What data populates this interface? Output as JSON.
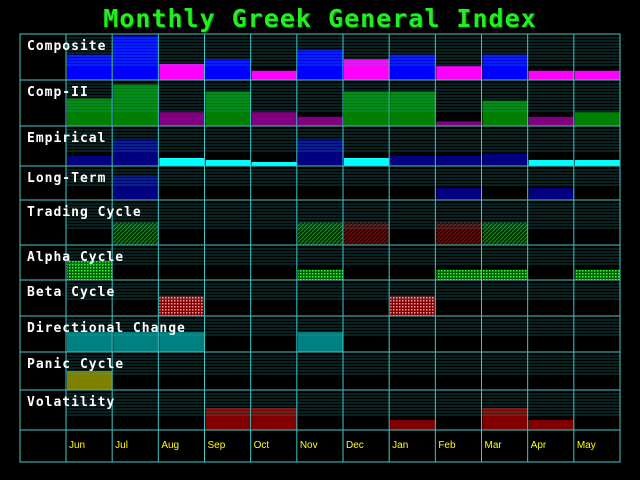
{
  "title": "Monthly Greek General Index",
  "chart_data": {
    "type": "heatmap",
    "title": "Monthly Greek General Index",
    "months": [
      "Jun",
      "Jul",
      "Aug",
      "Sep",
      "Oct",
      "Nov",
      "Dec",
      "Jan",
      "Feb",
      "Mar",
      "Apr",
      "May"
    ],
    "rows": [
      {
        "name": "Composite",
        "color": "#0000ff",
        "alt_color": "#ff00ff",
        "values": [
          0.55,
          0.95,
          0.35,
          0.45,
          0.2,
          0.65,
          0.45,
          0.55,
          0.3,
          0.55,
          0.2,
          0.2
        ],
        "alt": [
          false,
          false,
          true,
          false,
          true,
          false,
          true,
          false,
          true,
          false,
          true,
          true
        ]
      },
      {
        "name": "Comp-II",
        "color": "#008000",
        "alt_color": "#800080",
        "values": [
          0.6,
          0.9,
          0.3,
          0.75,
          0.3,
          0.2,
          0.75,
          0.75,
          0.1,
          0.55,
          0.2,
          0.3
        ],
        "alt": [
          false,
          false,
          true,
          false,
          true,
          true,
          false,
          false,
          true,
          false,
          true,
          false
        ]
      },
      {
        "name": "Empirical",
        "color": "#000080",
        "alt_color": "#00ffff",
        "values": [
          0.25,
          0.65,
          0.2,
          0.15,
          0.1,
          0.65,
          0.2,
          0.25,
          0.25,
          0.3,
          0.15,
          0.15
        ],
        "alt": [
          false,
          false,
          true,
          true,
          true,
          false,
          true,
          false,
          false,
          false,
          true,
          true
        ]
      },
      {
        "name": "Long-Term",
        "color": "#000080",
        "values": [
          0,
          0.7,
          0,
          0,
          0,
          0,
          0,
          0,
          0.35,
          0,
          0.35,
          0
        ]
      },
      {
        "name": "Trading Cycle",
        "color": "#006000",
        "alt_color": "#600000",
        "values": [
          0,
          0.5,
          0,
          0,
          0,
          0.5,
          0.5,
          0,
          0.5,
          0.5,
          0,
          0
        ],
        "alt": [
          false,
          false,
          false,
          false,
          false,
          false,
          true,
          false,
          true,
          false,
          false,
          false
        ],
        "pattern": "hatch"
      },
      {
        "name": "Alpha Cycle",
        "color": "#00aa00",
        "values": [
          0.55,
          0,
          0,
          0,
          0,
          0.3,
          0,
          0,
          0.3,
          0.3,
          0,
          0.3
        ],
        "pattern": "dots"
      },
      {
        "name": "Beta Cycle",
        "color": "#aa0000",
        "values": [
          0,
          0,
          0.55,
          0,
          0,
          0,
          0,
          0.55,
          0,
          0,
          0,
          0
        ],
        "pattern": "dots"
      },
      {
        "name": "Directional Change",
        "color": "#008080",
        "values": [
          0.55,
          0.55,
          0.55,
          0,
          0,
          0.55,
          0,
          0,
          0,
          0,
          0,
          0
        ]
      },
      {
        "name": "Panic Cycle",
        "color": "#808000",
        "values": [
          0.5,
          0,
          0,
          0,
          0,
          0,
          0,
          0,
          0,
          0,
          0,
          0
        ]
      },
      {
        "name": "Volatility",
        "color": "#800000",
        "values": [
          0,
          0,
          0,
          0.55,
          0.55,
          0,
          0,
          0.25,
          0,
          0.55,
          0.25,
          0
        ]
      }
    ],
    "grid": true
  }
}
